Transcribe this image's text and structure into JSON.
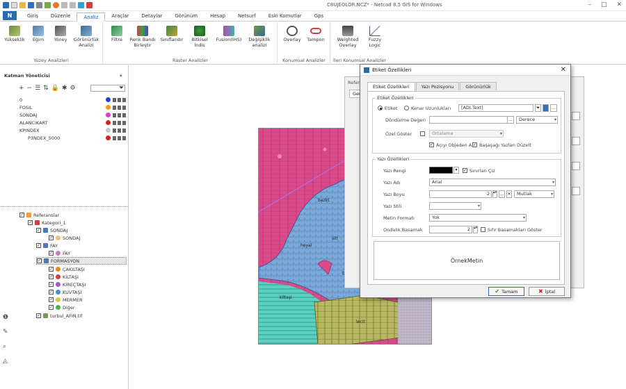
{
  "window": {
    "title": "C8UJEOLOR.NCZ* - Netcad 8.5 GIS for Windows"
  },
  "menu": [
    "Giriş",
    "Düzenle",
    "Analiz",
    "Araçlar",
    "Detaylar",
    "Görünüm",
    "Hesap",
    "Netsurf",
    "Eski Komutlar",
    "Gps"
  ],
  "ribbon": {
    "groups": [
      {
        "label": "Yüzey Analizleri",
        "buttons": [
          "Yükseklik",
          "Eğim",
          "Yöney",
          "Görünürlük Analizi"
        ]
      },
      {
        "label": "Raster Analizler",
        "buttons": [
          "Filtre",
          "Renk Bandı Birleştir",
          "Sınıflandır",
          "Bitkisel İndis",
          "Fusion(IHS)",
          "Değişiklik analizi"
        ]
      },
      {
        "label": "Konumsal Analizler",
        "buttons": [
          "Overlay",
          "Tampon"
        ]
      },
      {
        "label": "İleri Konumsal Analizler",
        "buttons": [
          "Weighted Overlay",
          "Fuzzy Logic"
        ]
      }
    ]
  },
  "layer_panel": {
    "title": "Katman Yöneticisi",
    "layers": [
      {
        "name": "0",
        "color": "#1f3fd6"
      },
      {
        "name": "FOSIL",
        "color": "#f59a1a"
      },
      {
        "name": "SONDAJ",
        "color": "#d63fd6"
      },
      {
        "name": "ALANCIKART",
        "color": "#d62020"
      },
      {
        "name": "KPINDEX",
        "color": "#c8c8c8"
      },
      {
        "name": "P3NDEX_5000",
        "color": "#d62020"
      }
    ]
  },
  "reference_tree": {
    "root": "Referanslar",
    "group": "Kategori_1",
    "items": [
      {
        "name": "SONDAJ",
        "child": "SONDAJ"
      },
      {
        "name": "FAY",
        "child": "FAY"
      },
      {
        "name": "FORMASYON",
        "child": null
      }
    ],
    "formations": [
      {
        "name": "ÇAKILTAŞI",
        "color": "#e08a20"
      },
      {
        "name": "KİLTAŞI",
        "color": "#d04040"
      },
      {
        "name": "KİREÇTAŞI",
        "color": "#9a60c0"
      },
      {
        "name": "KUVTAŞI",
        "color": "#4a90d0"
      },
      {
        "name": "MERMER",
        "color": "#d8c84a"
      },
      {
        "name": "Diğer",
        "color": "#50b050"
      }
    ],
    "last": "turbul_AFIN.tif"
  },
  "map_labels": [
    "bazkt",
    "silt",
    "kiltaşi",
    "lecit",
    "heyal",
    "bazit"
  ],
  "dialog": {
    "title": "Etiket Özellikleri",
    "tabs": [
      "Etiket Özellikleri",
      "Yazı Pozisyonu",
      "Görünürlük"
    ],
    "section1": {
      "legend": "Etiket Özellikleri",
      "radio_etiket": "Etiket",
      "radio_kenar": "Kenar Uzunlukları",
      "text_value": "[ADI.Text]",
      "rotation_label": "Döndürme Değeri",
      "unit_value": "Derece",
      "filter_label": "Özel Göster",
      "filter_value": "Ortalama",
      "chk1": "Açıyı Objeden Al",
      "chk2": "Başaşağı Yazları Düzelt"
    },
    "section2": {
      "legend": "Yazı Özellikleri",
      "color_label": "Yazı Rengi",
      "border_label": "Sınırları Çiz",
      "font_label": "Yazı Adı",
      "font_value": "Arial",
      "size_label": "Yazı Boyu",
      "size_value": "2",
      "size_unit": "Mutlak",
      "style_label": "Yazı Stili",
      "format_label": "Metin Formatı",
      "format_value": "Yok",
      "decimal_label": "Ondalık Basamak",
      "decimal_value": "2",
      "zero_label": "Sıfır Basamakları Göster"
    },
    "preview_text": "ÖrnekMetin",
    "ok": "Tamam",
    "cancel": "İptal"
  },
  "background_dialog": {
    "title": "Referans",
    "tab": "Gen"
  }
}
